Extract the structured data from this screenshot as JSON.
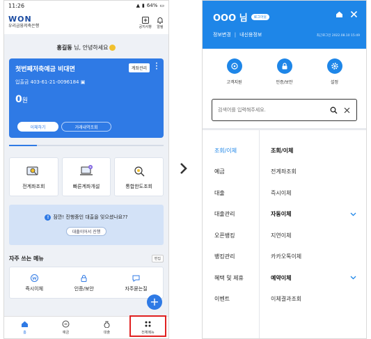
{
  "left": {
    "status": {
      "time": "11:26",
      "battery": "64%"
    },
    "header": {
      "logo": "WON",
      "logo_sub": "우리금융저축은행",
      "notice_label": "공지사항",
      "alarm_label": "알림"
    },
    "greeting": {
      "name": "홍길동",
      "text": " 님, 안녕하세요"
    },
    "account": {
      "name": "첫번째저축예금 비대면",
      "manage_label": "계좌관리",
      "number_label": "입출금",
      "number": "403-61-21-0096184",
      "balance": "0",
      "currency": "원",
      "transfer_label": "이체하기",
      "history_label": "거래내역조회"
    },
    "menu": [
      {
        "label": "전계좌조회"
      },
      {
        "label": "빠른계좌개설"
      },
      {
        "label": "통합한도조회"
      }
    ],
    "loan": {
      "question": "잠깐! 진행중인 대출을 잊으셨나요??",
      "button": "대출이어서 진행"
    },
    "favorites": {
      "title": "자주 쓰는 메뉴",
      "edit_label": "편집",
      "items": [
        {
          "label": "즉시이체"
        },
        {
          "label": "인증/보안"
        },
        {
          "label": "자주묻는질"
        }
      ]
    },
    "nav": [
      {
        "label": "홈"
      },
      {
        "label": "예금"
      },
      {
        "label": "대출"
      },
      {
        "label": "전체메뉴"
      }
    ],
    "colors": {
      "brand": "#2f7ae5",
      "highlight": "#e02020"
    }
  },
  "right": {
    "user": {
      "name": "OOO",
      "suffix": "님",
      "logout_label": "로그아웃"
    },
    "links": {
      "edit_info": "정보변경",
      "separator": "|",
      "my_info": "내신용정보"
    },
    "last_login": "최근로그인 2022.08.10 15:49",
    "quick": [
      {
        "label": "고객지원"
      },
      {
        "label": "인증/보안"
      },
      {
        "label": "설정"
      }
    ],
    "search": {
      "placeholder": "검색어를 입력해주세요."
    },
    "categories": [
      {
        "label": "조회/이체"
      },
      {
        "label": "예금"
      },
      {
        "label": "대출"
      },
      {
        "label": "대출관리"
      },
      {
        "label": "오픈뱅킹"
      },
      {
        "label": "뱅킹관리"
      },
      {
        "label": "혜택 및 제휴"
      },
      {
        "label": "이벤트"
      }
    ],
    "subs": [
      {
        "label": "조회/이체"
      },
      {
        "label": "전계좌조회"
      },
      {
        "label": "즉시이체"
      },
      {
        "label": "자동이체"
      },
      {
        "label": "지연이체"
      },
      {
        "label": "카카오톡이체"
      },
      {
        "label": "예약이체"
      },
      {
        "label": "이체결과조회"
      }
    ],
    "colors": {
      "brand": "#1e86e8"
    }
  }
}
